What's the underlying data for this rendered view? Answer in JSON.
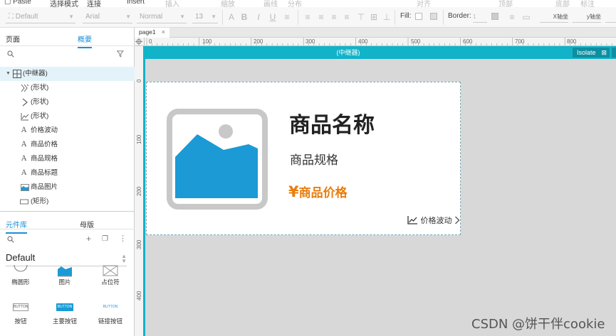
{
  "menubar": {
    "paste_label": "Paste",
    "items": [
      "选择模式",
      "连接",
      "Insert",
      "插入",
      "缩放",
      "画线",
      "分布",
      "对齐",
      "顶部",
      "底部",
      "标注"
    ]
  },
  "toolbar": {
    "style_value": "Default",
    "font_value": "Arial",
    "weight_value": "Normal",
    "size_value": "13",
    "fill_label": "Fill:",
    "border_label": "Border:",
    "border_value": "1",
    "x_label": "X轴坐",
    "y_label": "y轴坐"
  },
  "left_panel": {
    "tabs": [
      "页面",
      "概要"
    ],
    "active_tab": "概要",
    "tree": [
      {
        "label": "(中继器)",
        "icon": "repeater-icon"
      },
      {
        "label": "(形状)",
        "icon": "shape-icon"
      },
      {
        "label": "(形状)",
        "icon": "chevron-shape-icon"
      },
      {
        "label": "(形状)",
        "icon": "chart-line-icon"
      },
      {
        "label": "价格波动",
        "icon": "text-icon"
      },
      {
        "label": "商品价格",
        "icon": "text-icon"
      },
      {
        "label": "商品规格",
        "icon": "text-icon"
      },
      {
        "label": "商品标题",
        "icon": "text-icon"
      },
      {
        "label": "商品图片",
        "icon": "image-icon"
      },
      {
        "label": "(矩形)",
        "icon": "rectangle-icon"
      }
    ],
    "lib_tabs": [
      "元件库",
      "母版"
    ],
    "lib_active": "元件库",
    "library_name": "Default",
    "widgets": [
      {
        "label": "椭圆形",
        "icon": "ellipse-icon"
      },
      {
        "label": "图片",
        "icon": "image-icon"
      },
      {
        "label": "占位符",
        "icon": "placeholder-icon"
      },
      {
        "label": "按钮",
        "icon": "button-icon",
        "sample": "BUTTON"
      },
      {
        "label": "主要按钮",
        "icon": "primary-button-icon",
        "sample": "BUTTON"
      },
      {
        "label": "链接按钮",
        "icon": "link-button-icon",
        "sample": "BUTTON"
      }
    ]
  },
  "page_tab": {
    "label": "page1"
  },
  "rulers": {
    "h": [
      "0",
      "100",
      "200",
      "300",
      "400",
      "500",
      "600",
      "700",
      "800"
    ],
    "v": [
      "0",
      "100",
      "200",
      "300",
      "400"
    ]
  },
  "isolate_bar": {
    "title": "(中继器)",
    "button_label": "Isolate"
  },
  "card": {
    "title": "商品名称",
    "spec": "商品规格",
    "currency": "¥",
    "price": "商品价格",
    "fluctuation": "价格波动"
  },
  "colors": {
    "accent": "#11b3c9",
    "price": "#e87d0d",
    "image_blue": "#1b9ad6",
    "tab_active": "#1a8fd6"
  },
  "watermark": "CSDN @饼干伴cookie"
}
